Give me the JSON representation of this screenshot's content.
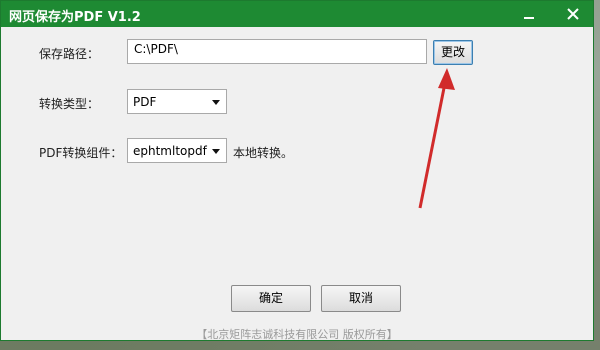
{
  "window": {
    "title": "网页保存为PDF  V1.2"
  },
  "form": {
    "save_path_label": "保存路径：",
    "save_path_value": "C:\\PDF\\",
    "change_button": "更改",
    "convert_type_label": "转换类型：",
    "convert_type_value": "PDF",
    "component_label": "PDF转换组件：",
    "component_value": "ephtmltopdf",
    "component_note": "本地转换。"
  },
  "actions": {
    "ok_button": "确定",
    "cancel_button": "取消"
  },
  "footer": {
    "copyright": "【北京矩阵志诚科技有限公司 版权所有】"
  },
  "colors": {
    "titlebar": "#1e8a33",
    "arrow": "#d12b2b"
  },
  "icons": [
    "minimize-icon",
    "close-icon",
    "dropdown-arrow-icon"
  ]
}
